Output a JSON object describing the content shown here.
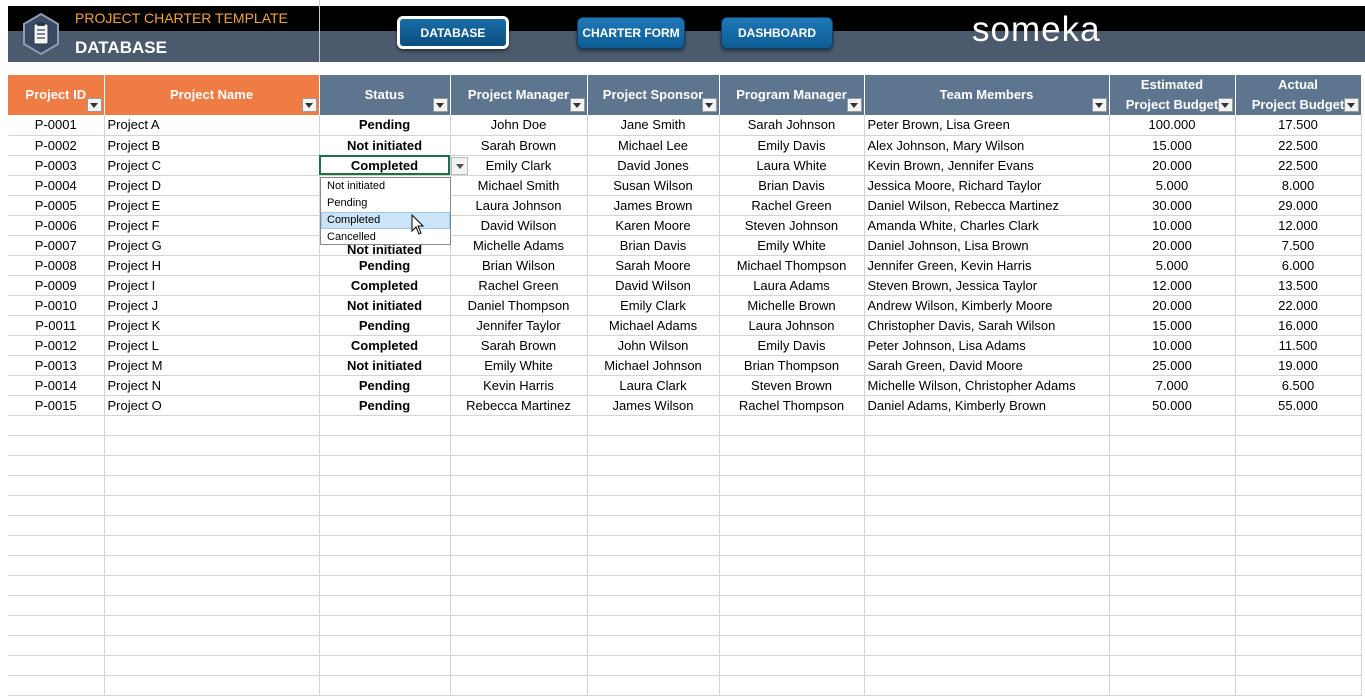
{
  "header": {
    "title": "PROJECT CHARTER TEMPLATE",
    "subtitle": "DATABASE",
    "brand": "someka",
    "nav": [
      {
        "label": "DATABASE"
      },
      {
        "label": "CHARTER FORM"
      },
      {
        "label": "DASHBOARD"
      }
    ]
  },
  "colors": {
    "orange_header": "#f07c45",
    "slate_header": "#5e7590",
    "pending": "#f0b253",
    "not_initiated": "#1f5f97",
    "completed": "#2faa52"
  },
  "table": {
    "columns": [
      {
        "label": "Project ID"
      },
      {
        "label": "Project Name"
      },
      {
        "label": "Status"
      },
      {
        "label": "Project Manager"
      },
      {
        "label": "Project Sponsor"
      },
      {
        "label": "Program Manager"
      },
      {
        "label": "Team Members"
      },
      {
        "label1": "Estimated",
        "label2": "Project Budget"
      },
      {
        "label1": "Actual",
        "label2": "Project Budget"
      }
    ],
    "rows": [
      {
        "id": "P-0001",
        "name": "Project A",
        "status": "Pending",
        "pm": "John Doe",
        "sponsor": "Jane Smith",
        "prog": "Sarah Johnson",
        "team": "Peter Brown, Lisa Green",
        "est": "100.000",
        "act": "17.500"
      },
      {
        "id": "P-0002",
        "name": "Project B",
        "status": "Not initiated",
        "pm": "Sarah Brown",
        "sponsor": "Michael Lee",
        "prog": "Emily Davis",
        "team": "Alex Johnson, Mary Wilson",
        "est": "15.000",
        "act": "22.500"
      },
      {
        "id": "P-0003",
        "name": "Project C",
        "status": "Completed",
        "pm": "Emily Clark",
        "sponsor": "David Jones",
        "prog": "Laura White",
        "team": "Kevin Brown, Jennifer Evans",
        "est": "20.000",
        "act": "22.500"
      },
      {
        "id": "P-0004",
        "name": "Project D",
        "status": "",
        "pm": "Michael Smith",
        "sponsor": "Susan Wilson",
        "prog": "Brian Davis",
        "team": "Jessica Moore, Richard Taylor",
        "est": "5.000",
        "act": "8.000"
      },
      {
        "id": "P-0005",
        "name": "Project E",
        "status": "",
        "pm": "Laura Johnson",
        "sponsor": "James Brown",
        "prog": "Rachel Green",
        "team": "Daniel Wilson, Rebecca Martinez",
        "est": "30.000",
        "act": "29.000"
      },
      {
        "id": "P-0006",
        "name": "Project F",
        "status": "",
        "pm": "David Wilson",
        "sponsor": "Karen Moore",
        "prog": "Steven Johnson",
        "team": "Amanda White, Charles Clark",
        "est": "10.000",
        "act": "12.000"
      },
      {
        "id": "P-0007",
        "name": "Project G",
        "status": "",
        "pm": "Michelle Adams",
        "sponsor": "Brian Davis",
        "prog": "Emily White",
        "team": "Daniel Johnson, Lisa Brown",
        "est": "20.000",
        "act": "7.500"
      },
      {
        "id": "P-0008",
        "name": "Project H",
        "status": "Pending",
        "pm": "Brian Wilson",
        "sponsor": "Sarah Moore",
        "prog": "Michael Thompson",
        "team": "Jennifer Green, Kevin Harris",
        "est": "5.000",
        "act": "6.000"
      },
      {
        "id": "P-0009",
        "name": "Project I",
        "status": "Completed",
        "pm": "Rachel Green",
        "sponsor": "David Wilson",
        "prog": "Laura Adams",
        "team": "Steven Brown, Jessica Taylor",
        "est": "12.000",
        "act": "13.500"
      },
      {
        "id": "P-0010",
        "name": "Project J",
        "status": "Not initiated",
        "pm": "Daniel Thompson",
        "sponsor": "Emily Clark",
        "prog": "Michelle Brown",
        "team": "Andrew Wilson, Kimberly Moore",
        "est": "20.000",
        "act": "22.000"
      },
      {
        "id": "P-0011",
        "name": "Project K",
        "status": "Pending",
        "pm": "Jennifer Taylor",
        "sponsor": "Michael Adams",
        "prog": "Laura Johnson",
        "team": "Christopher Davis, Sarah Wilson",
        "est": "15.000",
        "act": "16.000"
      },
      {
        "id": "P-0012",
        "name": "Project L",
        "status": "Completed",
        "pm": "Sarah Brown",
        "sponsor": "John Wilson",
        "prog": "Emily Davis",
        "team": "Peter Johnson, Lisa Adams",
        "est": "10.000",
        "act": "11.500"
      },
      {
        "id": "P-0013",
        "name": "Project M",
        "status": "Not initiated",
        "pm": "Emily White",
        "sponsor": "Michael Johnson",
        "prog": "Brian Thompson",
        "team": "Sarah Green, David Moore",
        "est": "25.000",
        "act": "19.000"
      },
      {
        "id": "P-0014",
        "name": "Project N",
        "status": "Pending",
        "pm": "Kevin Harris",
        "sponsor": "Laura Clark",
        "prog": "Steven Brown",
        "team": "Michelle Wilson, Christopher Adams",
        "est": "7.000",
        "act": "6.500"
      },
      {
        "id": "P-0015",
        "name": "Project O",
        "status": "Pending",
        "pm": "Rebecca Martinez",
        "sponsor": "James Wilson",
        "prog": "Rachel Thompson",
        "team": "Daniel Adams, Kimberly Brown",
        "est": "50.000",
        "act": "55.000"
      }
    ],
    "partial_status_row7": "Not initiated"
  },
  "dropdown": {
    "options": [
      "Not initiated",
      "Pending",
      "Completed",
      "Cancelled"
    ],
    "highlighted": "Completed"
  }
}
